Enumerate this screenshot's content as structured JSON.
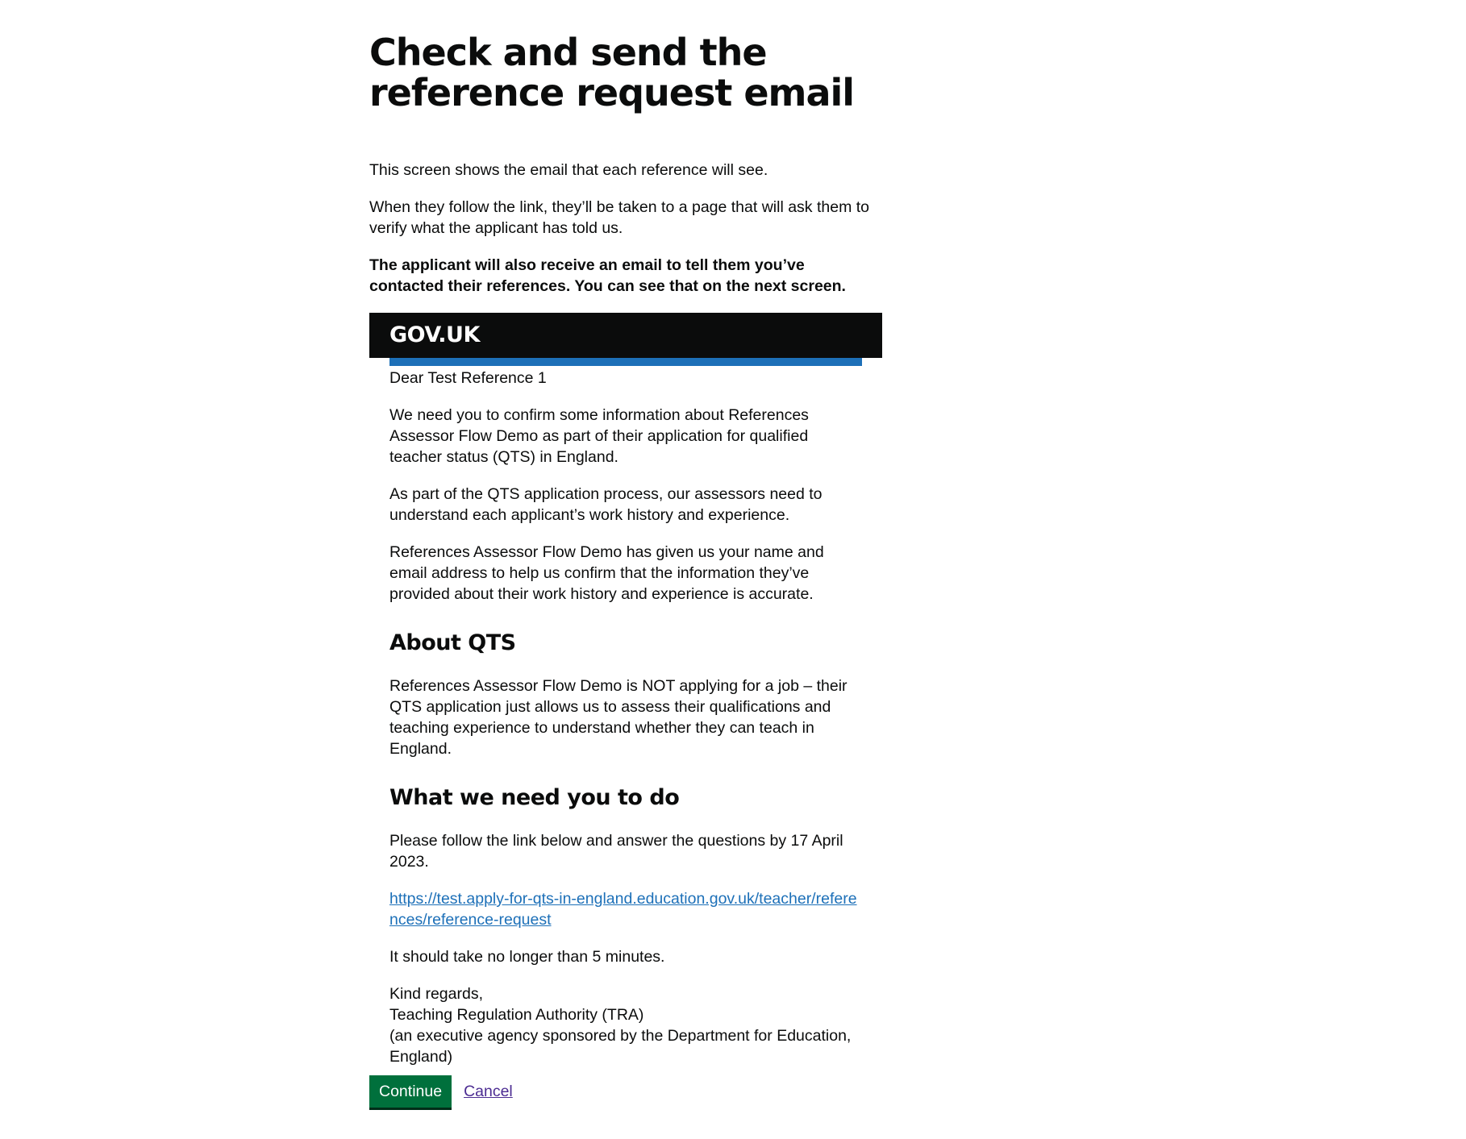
{
  "page": {
    "title": "Check and send the reference request email",
    "intro": [
      "This screen shows the email that each reference will see.",
      "When they follow the link, they’ll be taken to a page that will ask them to verify what the applicant has told us."
    ],
    "notice": "The applicant will also receive an email to tell them you’ve contacted their references. You can see that on the next screen."
  },
  "email": {
    "logo": "GOV.UK",
    "greeting": "Dear Test Reference 1",
    "paragraphs": [
      "We need you to confirm some information about References Assessor Flow Demo as part of their application for qualified teacher status (QTS) in England.",
      "As part of the QTS application process, our assessors need to understand each applicant’s work history and experience.",
      "References Assessor Flow Demo has given us your name and email address to help us confirm that the information they’ve provided about their work history and experience is accurate."
    ],
    "about_heading": "About QTS",
    "about_text": "References Assessor Flow Demo is NOT applying for a job – their QTS application just allows us to assess their qualifications and teaching experience to understand whether they can teach in England.",
    "todo_heading": "What we need you to do",
    "todo_text": "Please follow the link below and answer the questions by 17 April 2023.",
    "link": "https://test.apply-for-qts-in-england.education.gov.uk/teacher/references/reference-request",
    "time_text": "It should take no longer than 5 minutes.",
    "signoff": [
      "Kind regards,",
      "Teaching Regulation Authority (TRA)",
      "(an executive agency sponsored by the Department for Education, England)"
    ]
  },
  "actions": {
    "continue_label": "Continue",
    "cancel_label": "Cancel"
  },
  "colors": {
    "header_bg": "#0b0c0c",
    "brand_bar": "#1d70b8",
    "button_green": "#00703c",
    "link_blue": "#1d70b8",
    "visited_link": "#4c2c92"
  }
}
